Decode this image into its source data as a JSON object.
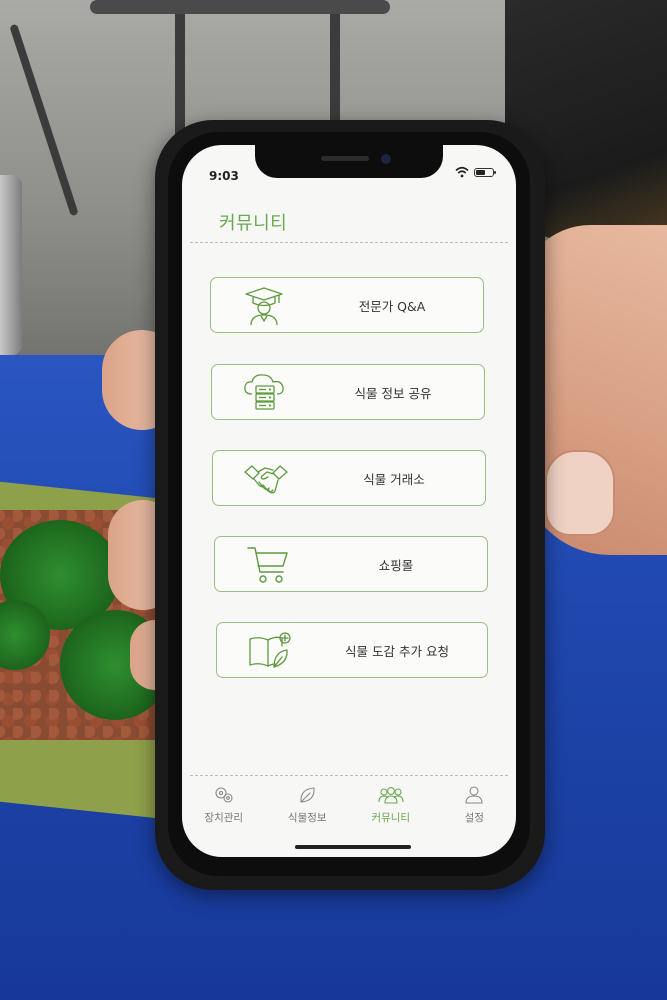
{
  "status_bar": {
    "time": "9:03",
    "icons": [
      "wifi-icon",
      "battery-icon"
    ]
  },
  "header": {
    "title": "커뮤니티"
  },
  "menu": {
    "items": [
      {
        "label": "전문가 Q&A",
        "icon": "graduate-icon"
      },
      {
        "label": "식물 정보 공유",
        "icon": "cloud-server-icon"
      },
      {
        "label": "식물 거래소",
        "icon": "handshake-icon"
      },
      {
        "label": "쇼핑몰",
        "icon": "cart-icon"
      },
      {
        "label": "식물 도감 추가 요청",
        "icon": "book-add-icon"
      }
    ]
  },
  "tab_bar": {
    "tabs": [
      {
        "label": "장치관리",
        "icon": "device-icon",
        "active": false
      },
      {
        "label": "식물정보",
        "icon": "leaf-icon",
        "active": false
      },
      {
        "label": "커뮤니티",
        "icon": "people-icon",
        "active": true
      },
      {
        "label": "설정",
        "icon": "user-icon",
        "active": false
      }
    ]
  },
  "colors": {
    "accent": "#6aa84f",
    "border": "#9bbe84",
    "icon_stroke": "#5e9a3f",
    "screen_bg": "#f7f7f6"
  }
}
